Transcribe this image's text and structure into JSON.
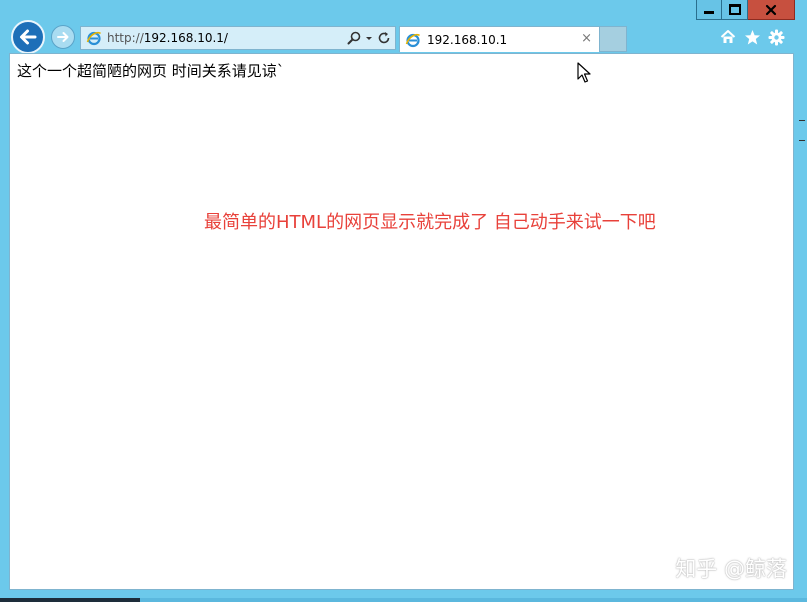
{
  "window": {
    "caption_buttons": [
      "minimize-icon",
      "maximize-icon",
      "close-icon"
    ],
    "frame_color": "#6cc9eb",
    "close_color": "#c7503f"
  },
  "nav": {
    "back_icon": "back-arrow-icon",
    "forward_icon": "forward-arrow-icon"
  },
  "address": {
    "protocol": "http://",
    "host": "192.168.10.1/",
    "site_icon": "ie-icon",
    "tools": [
      "search-icon",
      "dropdown-icon",
      "refresh-icon"
    ]
  },
  "tab": {
    "title": "192.168.10.1",
    "close_glyph": "×"
  },
  "toolbar": {
    "icons": [
      "home-icon",
      "favorites-star-icon",
      "settings-gear-icon"
    ]
  },
  "page": {
    "intro": "这个一个超简陋的网页  时间关系请见谅`",
    "headline": "最简单的HTML的网页显示就完成了 自己动手来试一下吧",
    "headline_color": "#e8413a",
    "watermark": "知乎 @鲸落"
  }
}
